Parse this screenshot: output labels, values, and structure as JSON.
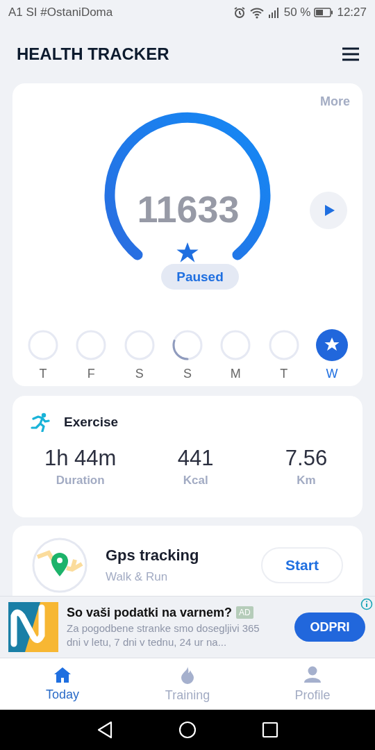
{
  "status_bar": {
    "carrier": "A1 SI #OstaniDoma",
    "battery": "50 %",
    "time": "12:27"
  },
  "header": {
    "title": "HEALTH TRACKER"
  },
  "steps_card": {
    "more": "More",
    "steps": "11633",
    "state": "Paused",
    "paused": true,
    "days": [
      {
        "label": "T",
        "kind": "empty",
        "selected": false
      },
      {
        "label": "F",
        "kind": "empty",
        "selected": false
      },
      {
        "label": "S",
        "kind": "empty",
        "selected": false
      },
      {
        "label": "S",
        "kind": "partial",
        "selected": false
      },
      {
        "label": "M",
        "kind": "empty",
        "selected": false
      },
      {
        "label": "T",
        "kind": "empty",
        "selected": false
      },
      {
        "label": "W",
        "kind": "goal",
        "selected": true
      }
    ]
  },
  "exercise": {
    "title": "Exercise",
    "stats": [
      {
        "value": "1h 44m",
        "label": "Duration"
      },
      {
        "value": "441",
        "label": "Kcal"
      },
      {
        "value": "7.56",
        "label": "Km"
      }
    ]
  },
  "gps": {
    "title": "Gps tracking",
    "subtitle": "Walk & Run",
    "button": "Start"
  },
  "ad": {
    "title": "So vaši podatki na varnem?",
    "badge": "AD",
    "text": "Za pogodbene stranke smo dosegljivi 365 dni v letu, 7 dni v tednu, 24 ur na...",
    "button": "ODPRI"
  },
  "bottom_nav": [
    {
      "label": "Today",
      "selected": true
    },
    {
      "label": "Training",
      "selected": false
    },
    {
      "label": "Profile",
      "selected": false
    }
  ]
}
